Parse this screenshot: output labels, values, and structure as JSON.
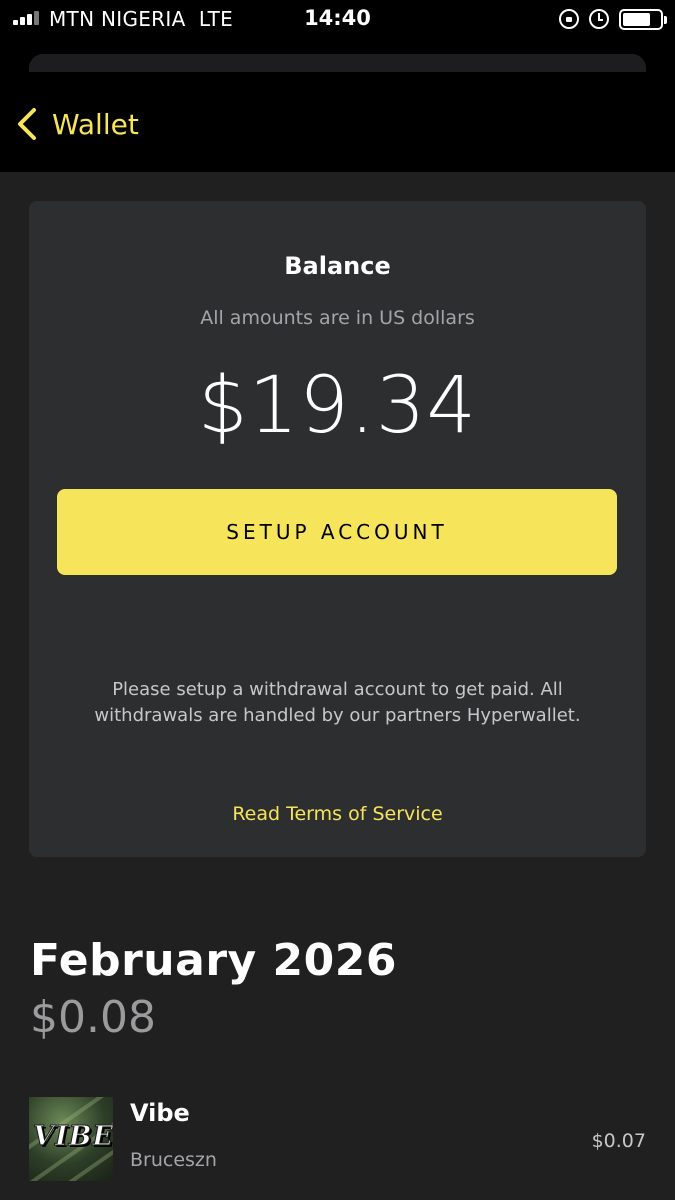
{
  "status_bar": {
    "carrier": "MTN NIGERIA",
    "network": "LTE",
    "time": "14:40"
  },
  "nav": {
    "back_label": "Wallet"
  },
  "balance": {
    "title": "Balance",
    "subtitle": "All amounts are in US dollars",
    "amount": "$19.34",
    "setup_button_label": "SETUP ACCOUNT",
    "info_text": "Please setup a withdrawal account to get paid. All withdrawals are handled by our partners Hyperwallet.",
    "terms_link": "Read Terms of Service"
  },
  "month": {
    "title": "February 2026",
    "total": "$0.08"
  },
  "earnings": [
    {
      "title": "Vibe",
      "artist": "Bruceszn",
      "amount": "$0.07",
      "cover_text": "VIBE"
    }
  ],
  "colors": {
    "accent": "#f6e45a",
    "background": "#202021",
    "card": "#2d2e30"
  }
}
